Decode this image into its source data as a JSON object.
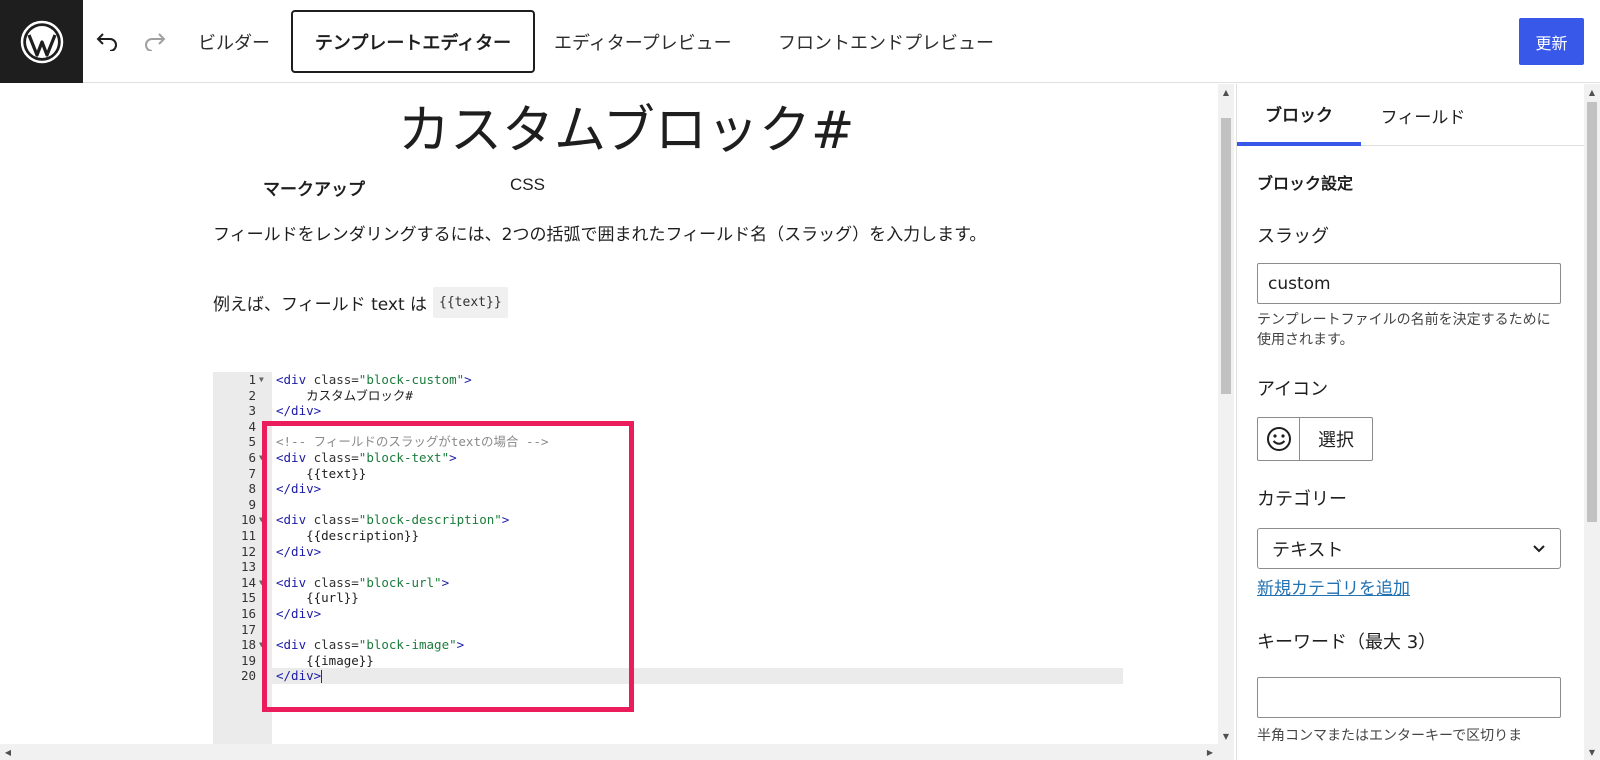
{
  "topbar": {
    "logo": "wordpress-icon",
    "undo": "undo-icon",
    "redo": "redo-icon",
    "tabs": [
      "ビルダー",
      "テンプレートエディター",
      "エディタープレビュー",
      "フロントエンドプレビュー"
    ],
    "active_tab": "テンプレートエディター",
    "update_label": "更新",
    "accent": "#3858e9"
  },
  "main": {
    "title": "カスタムブロック#",
    "subtabs": [
      "マークアップ",
      "CSS"
    ],
    "description": "フィールドをレンダリングするには、2つの括弧で囲まれたフィールド名（スラッグ）を入力します。",
    "example_text": "例えば、フィールド text は",
    "example_code": "{{text}}",
    "code_lines": [
      {
        "n": "1",
        "fold": true,
        "html": "<span class=\"tag\">&lt;div</span> <span class=\"attr\">class=</span><span class=\"str\">\"block-custom\"</span><span class=\"tag\">&gt;</span>"
      },
      {
        "n": "2",
        "fold": false,
        "html": "    カスタムブロック#"
      },
      {
        "n": "3",
        "fold": false,
        "html": "<span class=\"tag\">&lt;/div&gt;</span>"
      },
      {
        "n": "4",
        "fold": false,
        "html": ""
      },
      {
        "n": "5",
        "fold": false,
        "html": "<span class=\"cmt\">&lt;!-- フィールドのスラッグがtextの場合 --&gt;</span>"
      },
      {
        "n": "6",
        "fold": true,
        "html": "<span class=\"tag\">&lt;div</span> <span class=\"attr\">class=</span><span class=\"str\">\"block-text\"</span><span class=\"tag\">&gt;</span>"
      },
      {
        "n": "7",
        "fold": false,
        "html": "    {{text}}"
      },
      {
        "n": "8",
        "fold": false,
        "html": "<span class=\"tag\">&lt;/div&gt;</span>"
      },
      {
        "n": "9",
        "fold": false,
        "html": ""
      },
      {
        "n": "10",
        "fold": true,
        "html": "<span class=\"tag\">&lt;div</span> <span class=\"attr\">class=</span><span class=\"str\">\"block-description\"</span><span class=\"tag\">&gt;</span>"
      },
      {
        "n": "11",
        "fold": false,
        "html": "    {{description}}"
      },
      {
        "n": "12",
        "fold": false,
        "html": "<span class=\"tag\">&lt;/div&gt;</span>"
      },
      {
        "n": "13",
        "fold": false,
        "html": ""
      },
      {
        "n": "14",
        "fold": true,
        "html": "<span class=\"tag\">&lt;div</span> <span class=\"attr\">class=</span><span class=\"str\">\"block-url\"</span><span class=\"tag\">&gt;</span>"
      },
      {
        "n": "15",
        "fold": false,
        "html": "    {{url}}"
      },
      {
        "n": "16",
        "fold": false,
        "html": "<span class=\"tag\">&lt;/div&gt;</span>"
      },
      {
        "n": "17",
        "fold": false,
        "html": ""
      },
      {
        "n": "18",
        "fold": true,
        "html": "<span class=\"tag\">&lt;div</span> <span class=\"attr\">class=</span><span class=\"str\">\"block-image\"</span><span class=\"tag\">&gt;</span>"
      },
      {
        "n": "19",
        "fold": false,
        "html": "    {{image}}"
      },
      {
        "n": "20",
        "fold": false,
        "active": true,
        "html": "<span class=\"tag\">&lt;/div&gt;</span><span class=\"cursor\"></span>"
      }
    ],
    "highlight_color": "#ea1c5c"
  },
  "sidebar": {
    "tabs": [
      "ブロック",
      "フィールド"
    ],
    "active_tab": "ブロック",
    "heading": "ブロック設定",
    "slug_label": "スラッグ",
    "slug_value": "custom",
    "slug_help": "テンプレートファイルの名前を決定するために使用されます。",
    "icon_label": "アイコン",
    "icon_preview": "smiley-icon",
    "icon_select": "選択",
    "category_label": "カテゴリー",
    "category_value": "テキスト",
    "add_category": "新規カテゴリを追加",
    "keyword_label": "キーワード（最大 3）",
    "keyword_value": "",
    "keyword_help": "半角コンマまたはエンターキーで区切りま"
  }
}
